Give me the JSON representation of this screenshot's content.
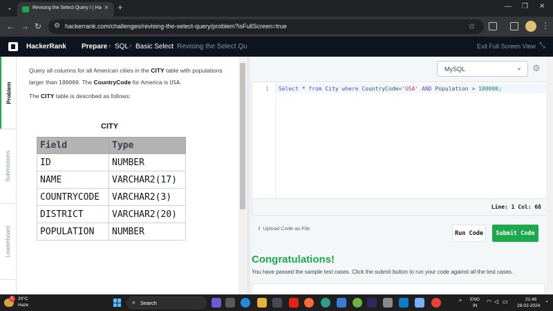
{
  "browser": {
    "tab_title": "Revising the Select Query I | HackerRank",
    "tab_close": "×",
    "new_tab": "+",
    "url": "hackerrank.com/challenges/revising-the-select-query/problem?isFullScreen=true"
  },
  "header": {
    "brand": "HackerRank",
    "breadcrumbs": [
      "Prepare",
      "SQL",
      "Basic Select",
      "Revising the Select Query I"
    ],
    "exit_fullscreen": "Exit Full Screen View"
  },
  "sidebar": {
    "tabs": [
      {
        "label": "Problem"
      },
      {
        "label": "Submissions"
      },
      {
        "label": "Leaderboard"
      }
    ]
  },
  "problem": {
    "p1_a": "Query all columns for all American cities in the ",
    "p1_b": "CITY",
    "p1_c": " table with populations larger than ",
    "p1_d": "100000",
    "p1_e": ". The ",
    "p1_f": "CountryCode",
    "p1_g": " for America is ",
    "p1_h": "USA",
    "p1_i": ".",
    "p2_a": "The ",
    "p2_b": "CITY",
    "p2_c": " table is described as follows:",
    "table_title": "CITY",
    "table_headers": [
      "Field",
      "Type"
    ],
    "table_rows": [
      [
        "ID",
        "NUMBER"
      ],
      [
        "NAME",
        "VARCHAR2(17)"
      ],
      [
        "COUNTRYCODE",
        "VARCHAR2(3)"
      ],
      [
        "DISTRICT",
        "VARCHAR2(20)"
      ],
      [
        "POPULATION",
        "NUMBER"
      ]
    ]
  },
  "editor": {
    "language": "MySQL",
    "line_number": "1",
    "code_tokens": {
      "t1": "Select",
      "t2": " * ",
      "t3": "from",
      "t4": " City ",
      "t5": "where",
      "t6": " CountryCode=",
      "t7": "'USA'",
      "t8": " ",
      "t9": "AND",
      "t10": " Population > ",
      "t11": "100000",
      "t12": ";"
    },
    "cursor_position": "Line: 1 Col: 68"
  },
  "actions": {
    "upload_label": "Upload Code as File",
    "run_label": "Run Code",
    "submit_label": "Submit Code"
  },
  "result": {
    "title": "Congratulations!",
    "message": "You have passed the sample test cases. Click the submit button to run your code against all the test cases."
  },
  "taskbar": {
    "weather_badge": "1",
    "temperature": "20°C",
    "condition": "Haze",
    "search_label": "Search",
    "lang_top": "ENG",
    "lang_bottom": "IN",
    "time": "21:48",
    "date": "28-02-2024"
  },
  "colors": {
    "accent_green": "#1ba94c",
    "header_bg": "#0e141e"
  }
}
